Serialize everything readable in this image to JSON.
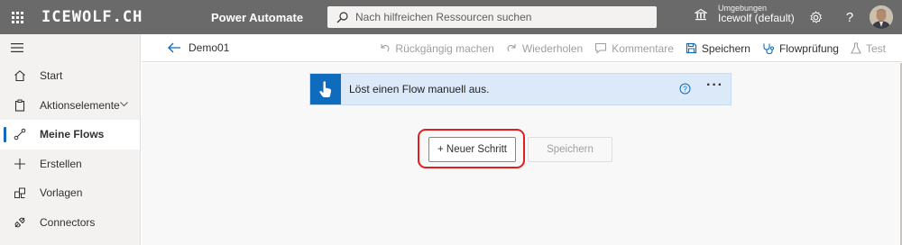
{
  "topbar": {
    "brand": "ICEWOLF.CH",
    "product": "Power Automate",
    "search_placeholder": "Nach hilfreichen Ressourcen suchen",
    "environment_label": "Umgebungen",
    "environment_name": "Icewolf (default)",
    "icons": [
      "waffle-icon",
      "search-icon",
      "environment-icon",
      "settings-icon",
      "help-icon",
      "avatar"
    ]
  },
  "nav": {
    "items": [
      {
        "label": "Start",
        "icon": "home-icon"
      },
      {
        "label": "Aktionselemente",
        "icon": "clipboard-icon",
        "expandable": true
      },
      {
        "label": "Meine Flows",
        "icon": "flow-icon",
        "active": true
      },
      {
        "label": "Erstellen",
        "icon": "plus-icon"
      },
      {
        "label": "Vorlagen",
        "icon": "templates-icon"
      },
      {
        "label": "Connectors",
        "icon": "connector-icon"
      }
    ]
  },
  "cmdbar": {
    "flow_name": "Demo01",
    "undo": "Rückgängig machen",
    "redo": "Wiederholen",
    "comments": "Kommentare",
    "save": "Speichern",
    "flow_checker": "Flowprüfung",
    "test": "Test"
  },
  "canvas": {
    "trigger_title": "Löst einen Flow manuell aus.",
    "new_step": "+ Neuer Schritt",
    "save": "Speichern"
  },
  "colors": {
    "topbar": "#6a6a6a",
    "accent": "#0f6cbd",
    "trigger_bg": "#dce9f8",
    "highlight": "#e02020"
  }
}
